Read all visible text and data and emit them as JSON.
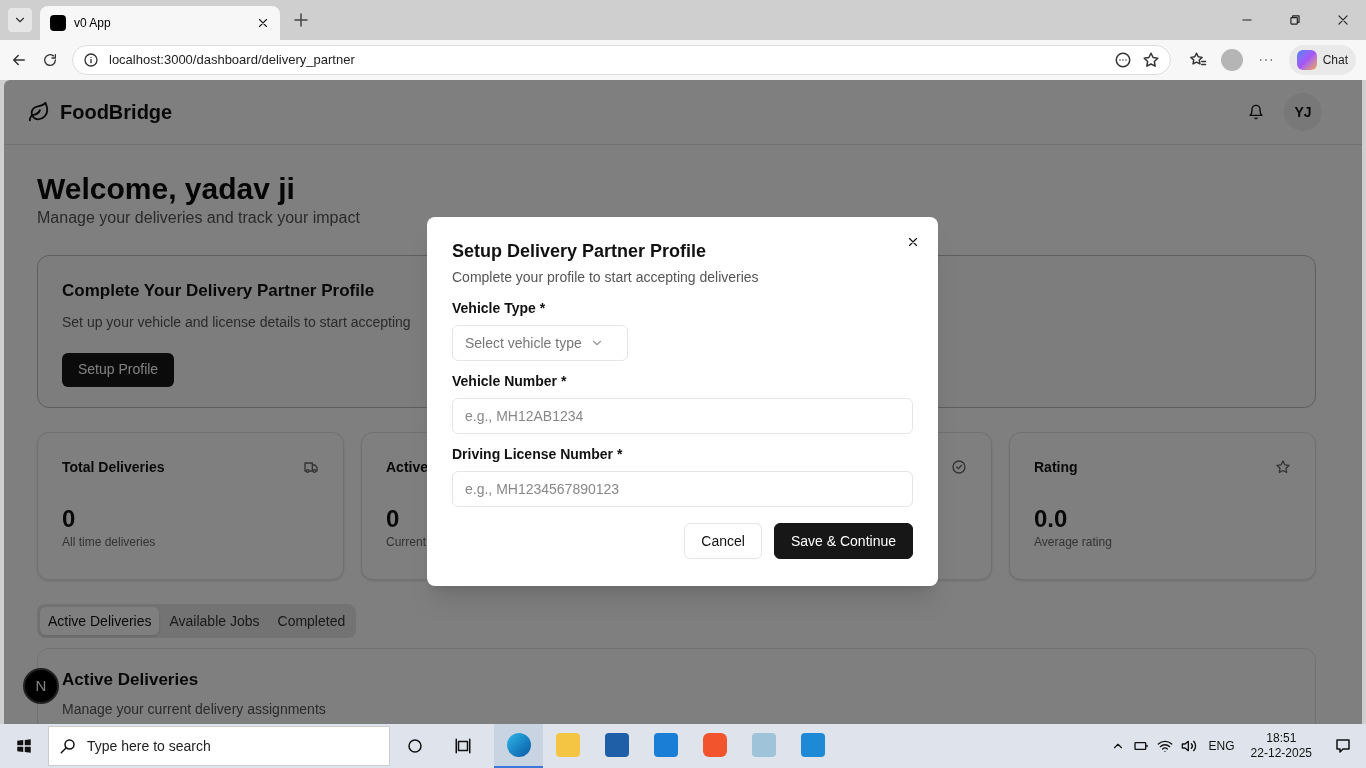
{
  "browser": {
    "tabs": [
      {
        "title": "v0 App",
        "selected": true
      }
    ],
    "url": "localhost:3000/dashboard/delivery_partner",
    "chat_label": "Chat"
  },
  "app": {
    "brand": "FoodBridge",
    "avatar_initials": "YJ",
    "welcome": "Welcome, yadav ji",
    "subtitle": "Manage your deliveries and track your impact",
    "profile_card": {
      "title": "Complete Your Delivery Partner Profile",
      "text": "Set up your vehicle and license details to start accepting",
      "button": "Setup Profile"
    },
    "stats": [
      {
        "kind": "truck",
        "title": "Total Deliveries",
        "value": "0",
        "caption": "All time deliveries"
      },
      {
        "kind": "none",
        "title": "Active",
        "value": "0",
        "caption": "Current"
      },
      {
        "kind": "check"
      },
      {
        "kind": "star",
        "title": "Rating",
        "value": "0.0",
        "caption": "Average rating"
      }
    ],
    "tabs": [
      {
        "label": "Active Deliveries",
        "selected": true
      },
      {
        "label": "Available Jobs",
        "selected": false
      },
      {
        "label": "Completed",
        "selected": false
      }
    ],
    "section": {
      "title": "Active Deliveries",
      "subtitle": "Manage your current delivery assignments"
    },
    "dev_badge": "N"
  },
  "dialog": {
    "title": "Setup Delivery Partner Profile",
    "description": "Complete your profile to start accepting deliveries",
    "fields": [
      {
        "kind": "select",
        "label": "Vehicle Type *",
        "placeholder": "Select vehicle type"
      },
      {
        "kind": "text",
        "label": "Vehicle Number *",
        "placeholder": "e.g., MH12AB1234"
      },
      {
        "kind": "text",
        "label": "Driving License Number *",
        "placeholder": "e.g., MH1234567890123"
      }
    ],
    "buttons": [
      {
        "kind": "secondary",
        "label": "Cancel"
      },
      {
        "kind": "primary",
        "label": "Save & Continue"
      }
    ]
  },
  "taskbar": {
    "search_placeholder": "Type here to search",
    "language": "ENG",
    "time": "18:51",
    "date": "22-12-2025"
  }
}
